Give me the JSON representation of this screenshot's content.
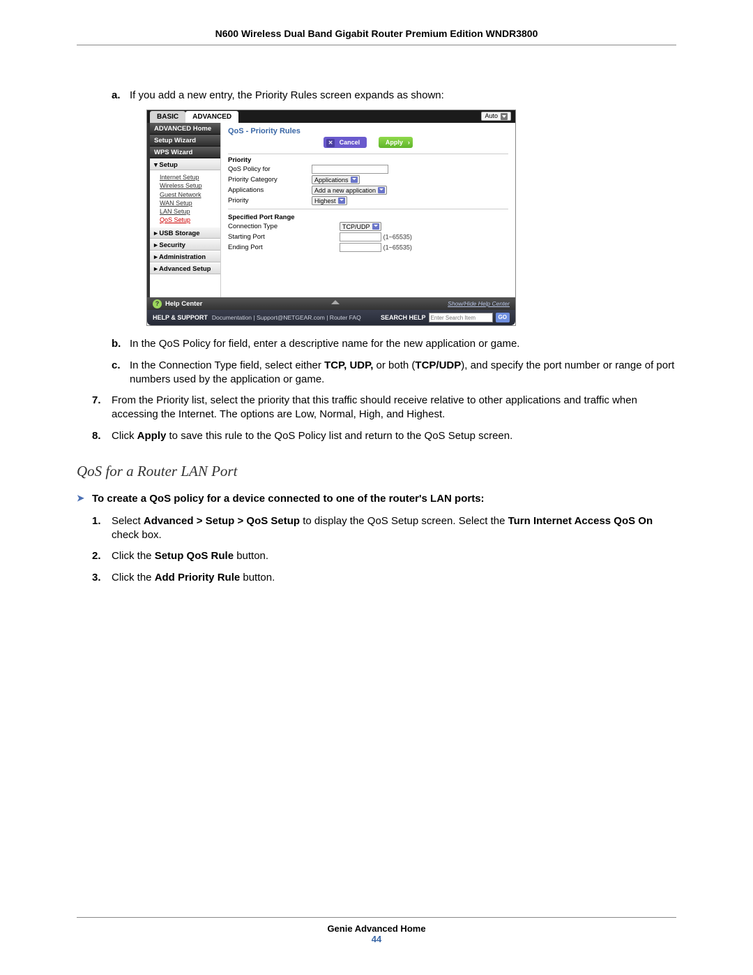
{
  "header": {
    "title": "N600 Wireless Dual Band Gigabit Router Premium Edition WNDR3800"
  },
  "steps": {
    "a": {
      "lt": "a.",
      "text": "If you add a new entry, the Priority Rules screen expands as shown:"
    },
    "b": {
      "lt": "b.",
      "text": "In the QoS Policy for field, enter a descriptive name for the new application or game."
    },
    "c": {
      "lt": "c.",
      "text_pre": "In the Connection Type field, select either ",
      "b1": "TCP, UDP,",
      "mid": " or both (",
      "b2": "TCP/UDP",
      "text_post": "), and specify the port number or range of port numbers used by the application or game."
    },
    "n7": {
      "lt": "7.",
      "text": "From the Priority list, select the priority that this traffic should receive relative to other applications and traffic when accessing the Internet. The options are Low, Normal, High, and Highest."
    },
    "n8": {
      "lt": "8.",
      "pre": "Click ",
      "b": "Apply",
      "post": " to save this rule to the QoS Policy list and return to the QoS Setup screen."
    }
  },
  "subheading": "QoS for a Router LAN Port",
  "task": {
    "arrow": "➤",
    "text": "To create a QoS policy for a device connected to one of the router's LAN ports:"
  },
  "proc": {
    "p1": {
      "lt": "1.",
      "a": "Select ",
      "b": "Advanced > Setup > QoS Setup",
      "c": "  to display the QoS Setup screen. Select the ",
      "d": "Turn Internet Access QoS On",
      "e": " check box."
    },
    "p2": {
      "lt": "2.",
      "a": "Click the ",
      "b": "Setup QoS Rule",
      "c": " button."
    },
    "p3": {
      "lt": "3.",
      "a": "Click the ",
      "b": "Add Priority Rule",
      "c": " button."
    }
  },
  "shot": {
    "tabs": {
      "basic": "BASIC",
      "advanced": "ADVANCED"
    },
    "auto": "Auto",
    "sidebar": {
      "adv_home": "ADVANCED Home",
      "setup_wizard": "Setup Wizard",
      "wps_wizard": "WPS Wizard",
      "setup": "▾ Setup",
      "subs": {
        "internet": "Internet Setup",
        "wireless": "Wireless Setup",
        "guest": "Guest Network",
        "wan": "WAN Setup",
        "lan": "LAN Setup",
        "qos": "QoS Setup"
      },
      "usb": "▸ USB Storage",
      "security": "▸ Security",
      "admin": "▸ Administration",
      "adv_setup": "▸ Advanced Setup"
    },
    "content": {
      "title": "QoS - Priority Rules",
      "cancel": "Cancel",
      "apply": "Apply",
      "priority_hdr": "Priority",
      "qos_policy_for": "QoS Policy for",
      "priority_category": "Priority Category",
      "applications": "Applications",
      "applications_sel": "Applications",
      "add_new_app": "Add a new application",
      "priority": "Priority",
      "highest": "Highest",
      "spec_port": "Specified Port Range",
      "conn_type": "Connection Type",
      "tcpudp": "TCP/UDP",
      "start_port": "Starting Port",
      "end_port": "Ending Port",
      "port_hint": "(1~65535)"
    },
    "helpbar": {
      "label": "Help Center",
      "show": "Show/Hide Help Center"
    },
    "support": {
      "label": "HELP & SUPPORT",
      "links": "Documentation | Support@NETGEAR.com | Router FAQ",
      "search": "SEARCH HELP",
      "placeholder": "Enter Search Item",
      "go": "GO"
    }
  },
  "footer": {
    "line1": "Genie Advanced Home",
    "page": "44"
  }
}
